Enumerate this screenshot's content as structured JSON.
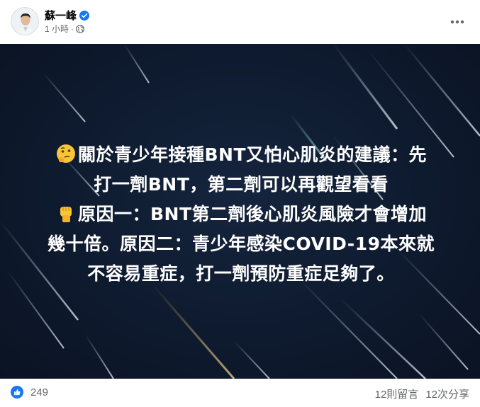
{
  "post": {
    "author": "蘇一峰",
    "time": "1 小時",
    "separator": "·"
  },
  "image_text": {
    "lines": [
      "關於青少年接種BNT又怕心肌炎的建議：先",
      "打一劑BNT，第二劑可以再觀望看看",
      "原因一：BNT第二劑後心肌炎風險才會增加",
      "幾十倍。原因二：青少年感染COVID-19本來就",
      "不容易重症，打一劑預防重症足夠了。"
    ]
  },
  "footer": {
    "likes": "249",
    "comments": "12則留言",
    "shares": "12次分享"
  },
  "colors": {
    "facebook_blue": "#1877f2",
    "image_background": "#0e1a2e",
    "secondary_text": "#65676b"
  },
  "icons": [
    "verified-icon",
    "globe-icon",
    "more-icon",
    "thinking-face-icon",
    "raised-fist-icon",
    "like-icon"
  ]
}
